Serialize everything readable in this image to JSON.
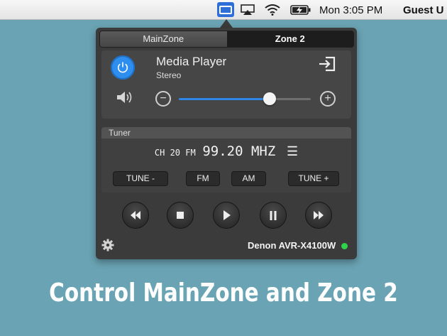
{
  "menubar": {
    "clock": "Mon 3:05 PM",
    "user": "Guest U"
  },
  "tabs": [
    "MainZone",
    "Zone 2"
  ],
  "source": {
    "name": "Media Player",
    "mode": "Stereo"
  },
  "volume": {
    "level_fraction": 0.69
  },
  "tuner": {
    "header": "Tuner",
    "channel": "CH 20 FM",
    "frequency": "99.20 MHZ",
    "menu_glyph": "☰",
    "buttons": {
      "tune_minus": "TUNE -",
      "fm": "FM",
      "am": "AM",
      "tune_plus": "TUNE +"
    }
  },
  "device": {
    "name": "Denon AVR-X4100W",
    "status_color": "#2ed34a"
  },
  "caption": "Control MainZone and Zone 2",
  "colors": {
    "accent": "#2d8ef0",
    "background": "#6aa3b3",
    "panel": "#3b3b3b"
  }
}
